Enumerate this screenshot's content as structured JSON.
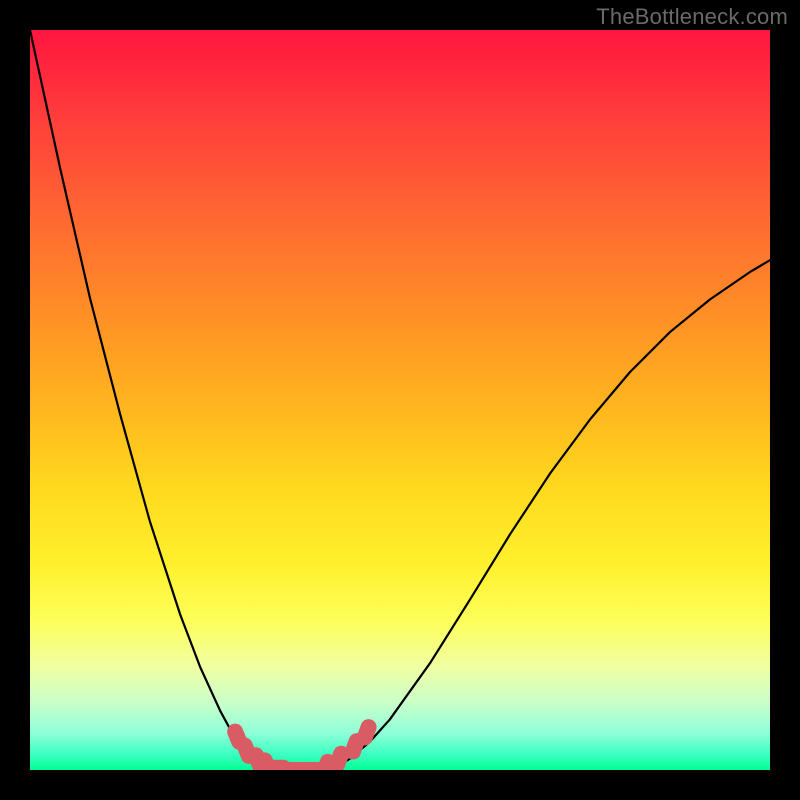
{
  "watermark": "TheBottleneck.com",
  "chart_data": {
    "type": "line",
    "title": "",
    "xlabel": "",
    "ylabel": "",
    "xlim": [
      0,
      1
    ],
    "ylim": [
      0,
      1
    ],
    "series": [
      {
        "name": "left-branch",
        "x": [
          0.0,
          0.041,
          0.081,
          0.122,
          0.162,
          0.203,
          0.23,
          0.257,
          0.27,
          0.284,
          0.297,
          0.311,
          0.324,
          0.338,
          0.351
        ],
        "y": [
          1.0,
          0.812,
          0.638,
          0.48,
          0.336,
          0.21,
          0.139,
          0.08,
          0.056,
          0.037,
          0.023,
          0.012,
          0.006,
          0.001,
          0.0
        ]
      },
      {
        "name": "floor",
        "x": [
          0.351,
          0.405
        ],
        "y": [
          0.0,
          0.0
        ]
      },
      {
        "name": "right-branch",
        "x": [
          0.405,
          0.432,
          0.459,
          0.486,
          0.541,
          0.595,
          0.649,
          0.703,
          0.757,
          0.811,
          0.865,
          0.919,
          0.973,
          1.0
        ],
        "y": [
          0.0,
          0.015,
          0.038,
          0.068,
          0.145,
          0.231,
          0.319,
          0.401,
          0.474,
          0.538,
          0.592,
          0.636,
          0.673,
          0.689
        ]
      },
      {
        "name": "markers-left",
        "x": [
          0.28,
          0.293,
          0.308,
          0.32,
          0.335,
          0.35,
          0.366,
          0.385
        ],
        "y": [
          0.045,
          0.026,
          0.013,
          0.006,
          0.003,
          0.0,
          0.0,
          0.0
        ]
      },
      {
        "name": "markers-right",
        "x": [
          0.4,
          0.418,
          0.439,
          0.455
        ],
        "y": [
          0.004,
          0.015,
          0.032,
          0.051
        ]
      }
    ],
    "colors": {
      "curve": "#000000",
      "markers": "#d95b63",
      "gradient_top": "#ff153f",
      "gradient_bottom": "#00ff94"
    }
  }
}
